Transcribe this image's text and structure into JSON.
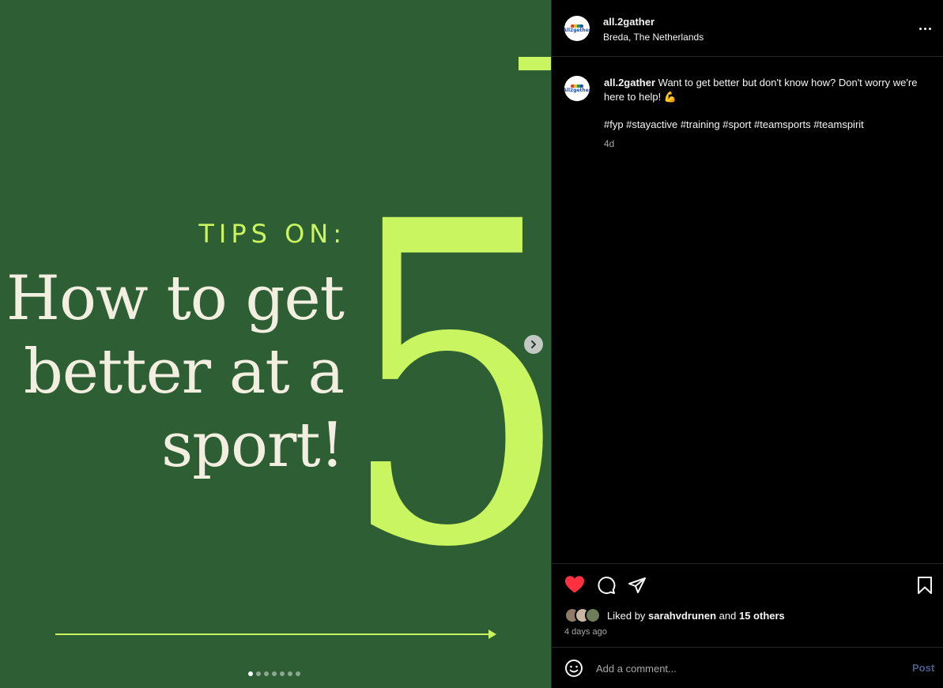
{
  "media": {
    "tips_label": "TIPS ON:",
    "headline_lines": [
      "How to get",
      "better at a",
      "sport!"
    ],
    "big_number": "5",
    "colors": {
      "background": "#2e5e34",
      "accent": "#c8f560",
      "text": "#f3efe0"
    },
    "carousel": {
      "total_slides": 7,
      "current_slide": 1
    },
    "next_icon": "chevron-right-icon"
  },
  "header": {
    "username": "all.2gather",
    "location": "Breda, The Netherlands",
    "more_icon": "more-horizontal-icon"
  },
  "caption": {
    "username": "all.2gather",
    "text": "Want to get better but don't know how? Don't worry we're here to help! 💪",
    "hashtags": "#fyp #stayactive #training #sport #teamsports #teamspirit",
    "age": "4d"
  },
  "actions": {
    "liked": true,
    "like_color": "#ff3040",
    "icons": [
      "heart-icon",
      "comment-icon",
      "share-icon",
      "bookmark-icon"
    ]
  },
  "likes": {
    "prefix": "Liked by",
    "first_liker": "sarahvdrunen",
    "joiner": "and",
    "others": "15 others"
  },
  "post_date": "4 days ago",
  "comment": {
    "placeholder": "Add a comment...",
    "post_label": "Post"
  }
}
